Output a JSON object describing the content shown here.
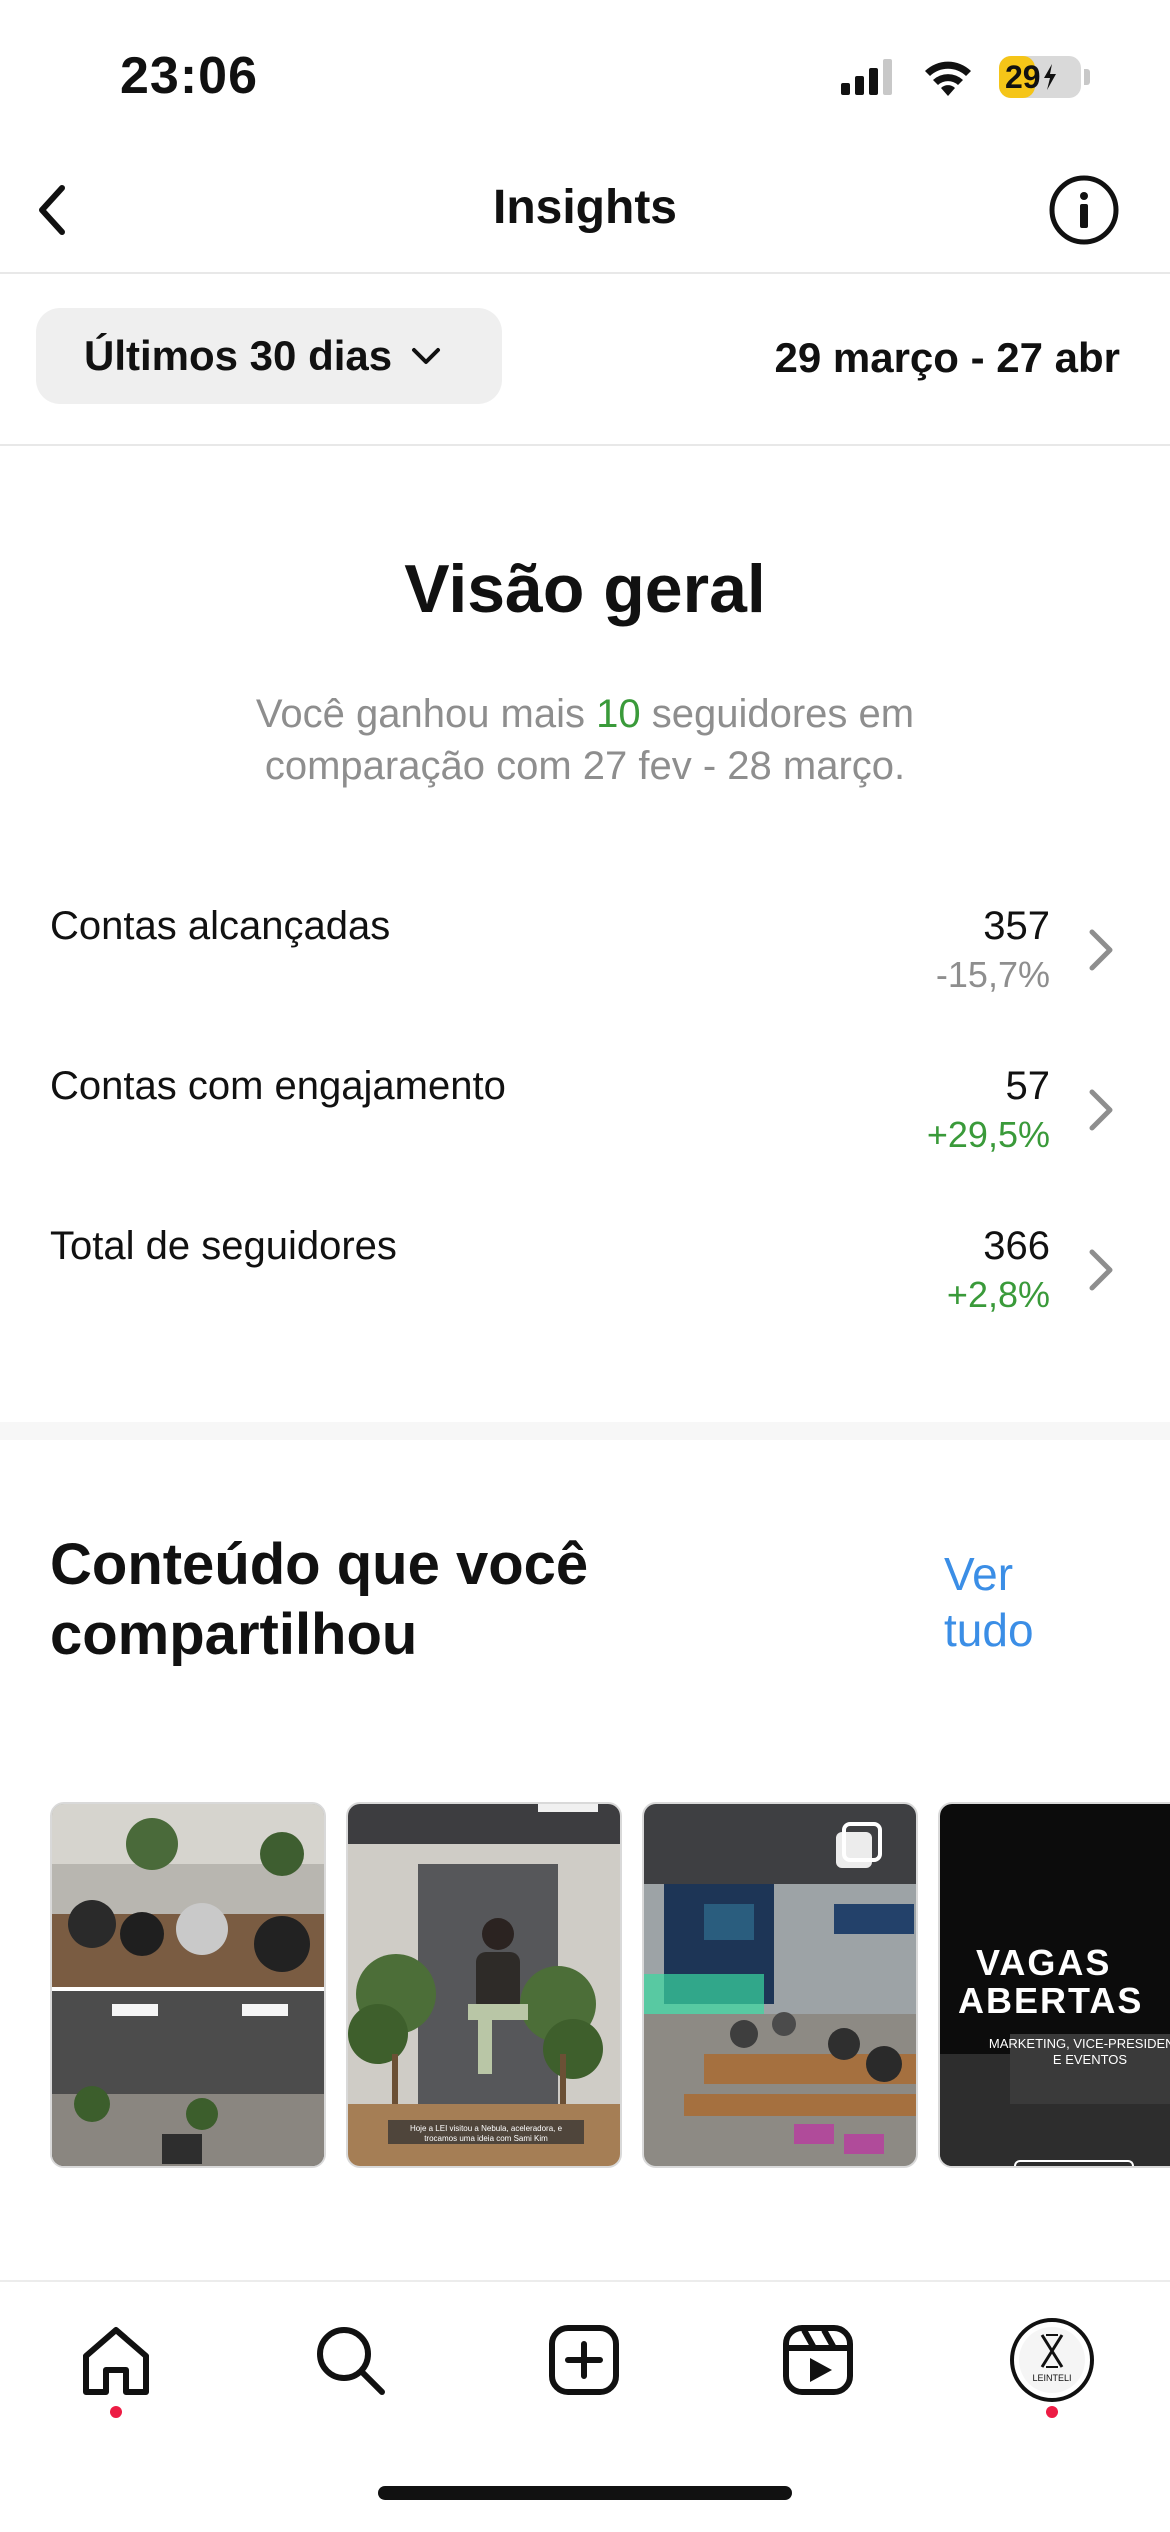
{
  "status_bar": {
    "time": "23:06",
    "battery_percent": "29",
    "battery_level": 0.29,
    "signal_icon": "cellular-signal-icon",
    "wifi_icon": "wifi-icon",
    "battery_icon": "battery-charging-icon"
  },
  "nav": {
    "title": "Insights",
    "back_icon": "chevron-left-icon",
    "info_icon": "info-circle-icon"
  },
  "filter": {
    "period_label": "Últimos 30 dias",
    "period_icon": "chevron-down-icon",
    "date_range": "29 março - 27 abr"
  },
  "overview": {
    "title": "Visão geral",
    "subtitle_before": "Você ganhou mais ",
    "subtitle_highlight": "10",
    "subtitle_after": " seguidores em comparação com 27 fev - 28 março.",
    "metrics": [
      {
        "label": "Contas alcançadas",
        "value": "357",
        "change": "-15,7%",
        "trend": "negative"
      },
      {
        "label": "Contas com engajamento",
        "value": "57",
        "change": "+29,5%",
        "trend": "positive"
      },
      {
        "label": "Total de seguidores",
        "value": "366",
        "change": "+2,8%",
        "trend": "positive"
      }
    ]
  },
  "content": {
    "title": "Conteúdo que você compartilhou",
    "see_all": "Ver tudo",
    "thumbnails": [
      {
        "description": "Group photo collage of a meeting room with plants"
      },
      {
        "description": "Man sitting on a stool between plants",
        "caption": "Hoje a LEI visitou a Nebula, aceleradora, e trocamos uma ideia com Sami Kim"
      },
      {
        "description": "Audience in a modern auditorium",
        "badge_icon": "carousel-icon"
      },
      {
        "description": "Recruitment poster",
        "headline_1": "VAGAS",
        "headline_2": "ABERTAS",
        "subtext_1": "MARKETING, VICE-PRESIDENTE",
        "subtext_2": "E EVENTOS"
      }
    ]
  },
  "tabbar": {
    "items": [
      {
        "name": "home",
        "icon": "home-icon",
        "has_dot": true
      },
      {
        "name": "search",
        "icon": "search-icon",
        "has_dot": false
      },
      {
        "name": "create",
        "icon": "plus-square-icon",
        "has_dot": false
      },
      {
        "name": "reels",
        "icon": "reels-icon",
        "has_dot": false
      },
      {
        "name": "profile",
        "icon": "avatar",
        "has_dot": true,
        "avatar_text": "LEINTELI"
      }
    ]
  },
  "colors": {
    "accent_blue": "#3b8ee6",
    "positive_green": "#3a9a3a",
    "neutral_gray": "#8e8e8e",
    "notification_red": "#ed1c44"
  }
}
